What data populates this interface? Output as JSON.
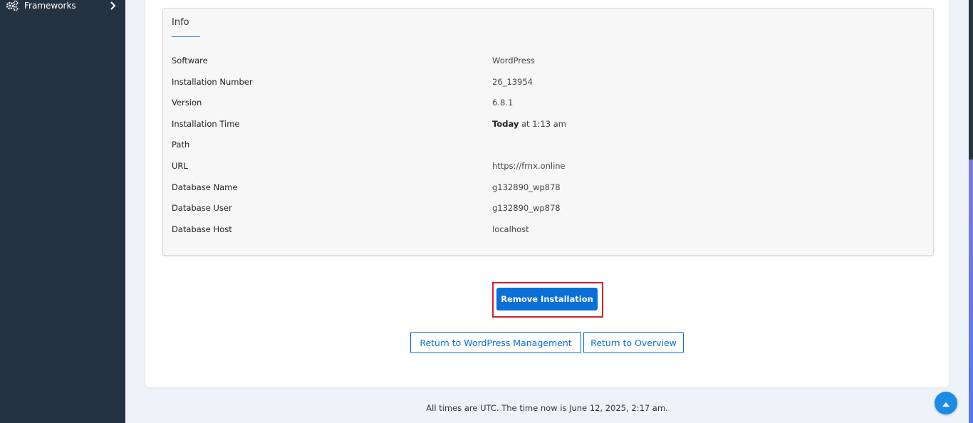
{
  "sidebar": {
    "items": [
      {
        "label": "Frameworks",
        "icon": "gears-icon",
        "chevron": "chevron-right-icon"
      }
    ],
    "background": "#243342"
  },
  "info": {
    "title": "Info",
    "rows": [
      {
        "label": "Software",
        "value": "WordPress"
      },
      {
        "label": "Installation Number",
        "value": "26_13954"
      },
      {
        "label": "Version",
        "value": "6.8.1"
      },
      {
        "label": "Installation Time",
        "value_bold": "Today",
        "value": " at 1:13 am"
      },
      {
        "label": "Path",
        "value": ""
      },
      {
        "label": "URL",
        "value": "https://frnx.online"
      },
      {
        "label": "Database Name",
        "value": "g132890_wp878"
      },
      {
        "label": "Database User",
        "value": "g132890_wp878"
      },
      {
        "label": "Database Host",
        "value": "localhost"
      }
    ]
  },
  "actions": {
    "remove_label": "Remove Installation",
    "return_wp_label": "Return to WordPress Management",
    "return_overview_label": "Return to Overview"
  },
  "footer": {
    "text": "All times are UTC. The time now is June 12, 2025, 2:17 am."
  },
  "colors": {
    "primary": "#0a6fd6",
    "highlight": "#d01f2a",
    "fab": "#1e8be3"
  },
  "fab_icon": "caret-up-icon"
}
